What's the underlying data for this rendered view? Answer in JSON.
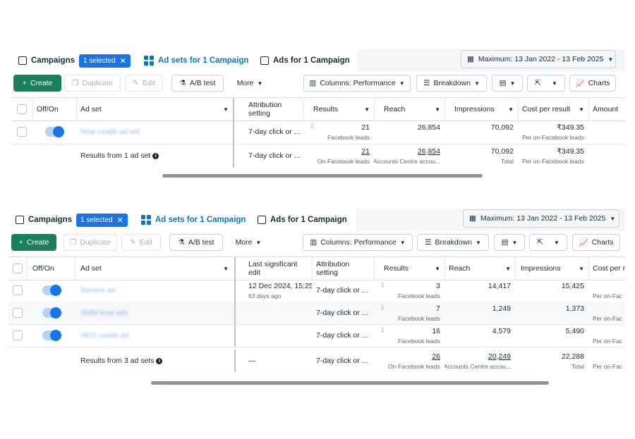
{
  "tabs": {
    "campaigns": "Campaigns",
    "selected_badge": "1 selected",
    "adsets": "Ad sets for 1 Campaign",
    "ads": "Ads for 1 Campaign"
  },
  "date_range": "Maximum: 13 Jan 2022 - 13 Feb 2025",
  "toolbar": {
    "create": "Create",
    "duplicate": "Duplicate",
    "edit": "Edit",
    "ab_test": "A/B test",
    "more": "More",
    "columns": "Columns: Performance",
    "breakdown": "Breakdown",
    "charts": "Charts"
  },
  "table1": {
    "headers": {
      "offon": "Off/On",
      "adset": "Ad set",
      "attribution": "Attribution setting",
      "results": "Results",
      "reach": "Reach",
      "impressions": "Impressions",
      "cpr": "Cost per result",
      "amount": "Amount"
    },
    "row": {
      "name": "New Leads ad set",
      "attribution": "7-day click or ...",
      "results": "21",
      "results_sub": "Facebook leads",
      "reach": "26,854",
      "impressions": "70,092",
      "cpr": "₹349.35",
      "cpr_sub": "Per on-Facebook leads"
    },
    "summary": {
      "label": "Results from 1 ad set",
      "attribution": "7-day click or ...",
      "results": "21",
      "results_sub": "On-Facebook leads",
      "reach": "26,854",
      "reach_sub": "Accounts Centre accou...",
      "impressions": "70,092",
      "impressions_sub": "Total",
      "cpr": "₹349.35",
      "cpr_sub": "Per on-Facebook leads"
    }
  },
  "table2": {
    "headers": {
      "offon": "Off/On",
      "adset": "Ad set",
      "last_edit": "Last significant edit",
      "attribution": "Attribution setting",
      "results": "Results",
      "reach": "Reach",
      "impressions": "Impressions",
      "cpr": "Cost per r"
    },
    "rows": [
      {
        "name": "Service ad",
        "last_edit": "12 Dec 2024, 15:25",
        "last_edit_sub": "63 days ago",
        "attribution": "7-day click or ...",
        "results": "3",
        "results_sub": "Facebook leads",
        "reach": "14,417",
        "impressions": "15,425",
        "cpr_sub": "Per on-Fac"
      },
      {
        "name": "SMM lead ads",
        "last_edit": "",
        "last_edit_sub": "",
        "attribution": "7-day click or ...",
        "results": "7",
        "results_sub": "Facebook leads",
        "reach": "1,249",
        "impressions": "1,373",
        "cpr_sub": "Per on-Fac"
      },
      {
        "name": "SEO Leads ad",
        "last_edit": "",
        "last_edit_sub": "",
        "attribution": "7-day click or ...",
        "results": "16",
        "results_sub": "Facebook leads",
        "reach": "4,579",
        "impressions": "5,490",
        "cpr_sub": "Per on-Fac"
      }
    ],
    "summary": {
      "label": "Results from 3 ad sets",
      "last_edit": "—",
      "attribution": "7-day click or ...",
      "results": "26",
      "results_sub": "On-Facebook leads",
      "reach": "20,249",
      "reach_sub": "Accounts Centre accou...",
      "impressions": "22,288",
      "impressions_sub": "Total",
      "cpr_sub": "Per on-Fac"
    }
  },
  "colors": {
    "accent": "#1b74e4",
    "create_green": "#1a7f5a",
    "tab_active_text": "#0a78be"
  },
  "icons": [
    "campaign-folder-icon",
    "close-icon",
    "adset-grid-icon",
    "ad-square-icon",
    "calendar-icon",
    "plus-icon",
    "duplicate-icon",
    "pencil-icon",
    "flask-icon",
    "columns-icon",
    "breakdown-icon",
    "report-icon",
    "export-icon",
    "chart-icon",
    "download-icon",
    "info-icon"
  ]
}
